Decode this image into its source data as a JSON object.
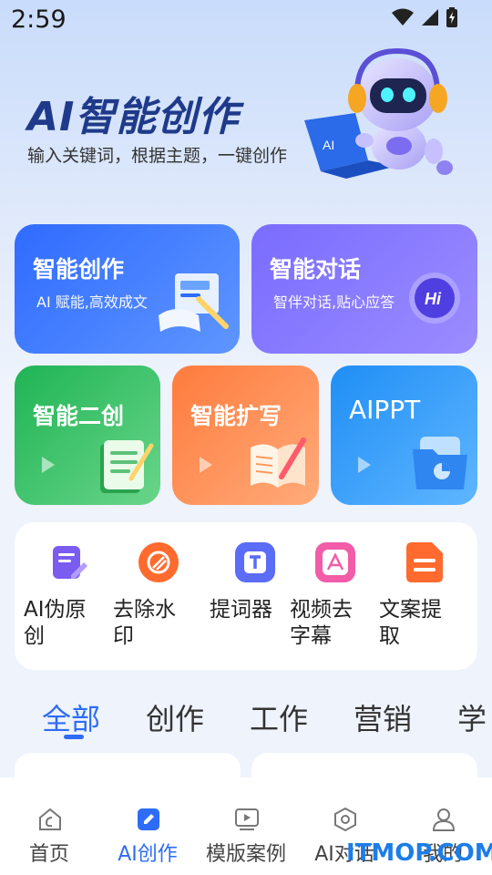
{
  "status_bar": {
    "time": "2:59"
  },
  "hero": {
    "title": "AI智能创作",
    "subtitle": "输入关键词，根据主题，一键创作",
    "laptop_text": "AI"
  },
  "cards": {
    "smart_create": {
      "title": "智能创作",
      "subtitle": "AI 赋能,高效成文"
    },
    "smart_chat": {
      "title": "智能对话",
      "subtitle": "智伴对话,贴心应答",
      "badge": "Hi"
    },
    "smart_remix": {
      "title": "智能二创"
    },
    "smart_expand": {
      "title": "智能扩写"
    },
    "aippt": {
      "title": "AIPPT"
    }
  },
  "tools": [
    {
      "label": "AI伪原创",
      "icon": "edit-doc-icon",
      "color": "#7b5cf0"
    },
    {
      "label": "去除水印",
      "icon": "eraser-circle-icon",
      "color": "#ff6a2e"
    },
    {
      "label": "提词器",
      "icon": "teleprompter-icon",
      "color": "#5b6cf6"
    },
    {
      "label": "视频去字幕",
      "icon": "video-subtitle-icon",
      "color": "#f25ca8"
    },
    {
      "label": "文案提取",
      "icon": "document-extract-icon",
      "color": "#ff6a2e"
    }
  ],
  "category_tabs": [
    {
      "label": "全部",
      "active": true
    },
    {
      "label": "创作",
      "active": false
    },
    {
      "label": "工作",
      "active": false
    },
    {
      "label": "营销",
      "active": false
    },
    {
      "label": "学",
      "active": false
    }
  ],
  "bottom_nav": [
    {
      "label": "首页",
      "icon": "home-icon",
      "active": false
    },
    {
      "label": "AI创作",
      "icon": "create-pen-icon",
      "active": true
    },
    {
      "label": "模版案例",
      "icon": "template-play-icon",
      "active": false
    },
    {
      "label": "AI对话",
      "icon": "chat-hex-icon",
      "active": false
    },
    {
      "label": "我的",
      "icon": "profile-icon",
      "active": false
    }
  ],
  "watermark": "ITMOP.COM",
  "colors": {
    "accent": "#2e6cf6",
    "title_blue": "#1f3a8a"
  }
}
